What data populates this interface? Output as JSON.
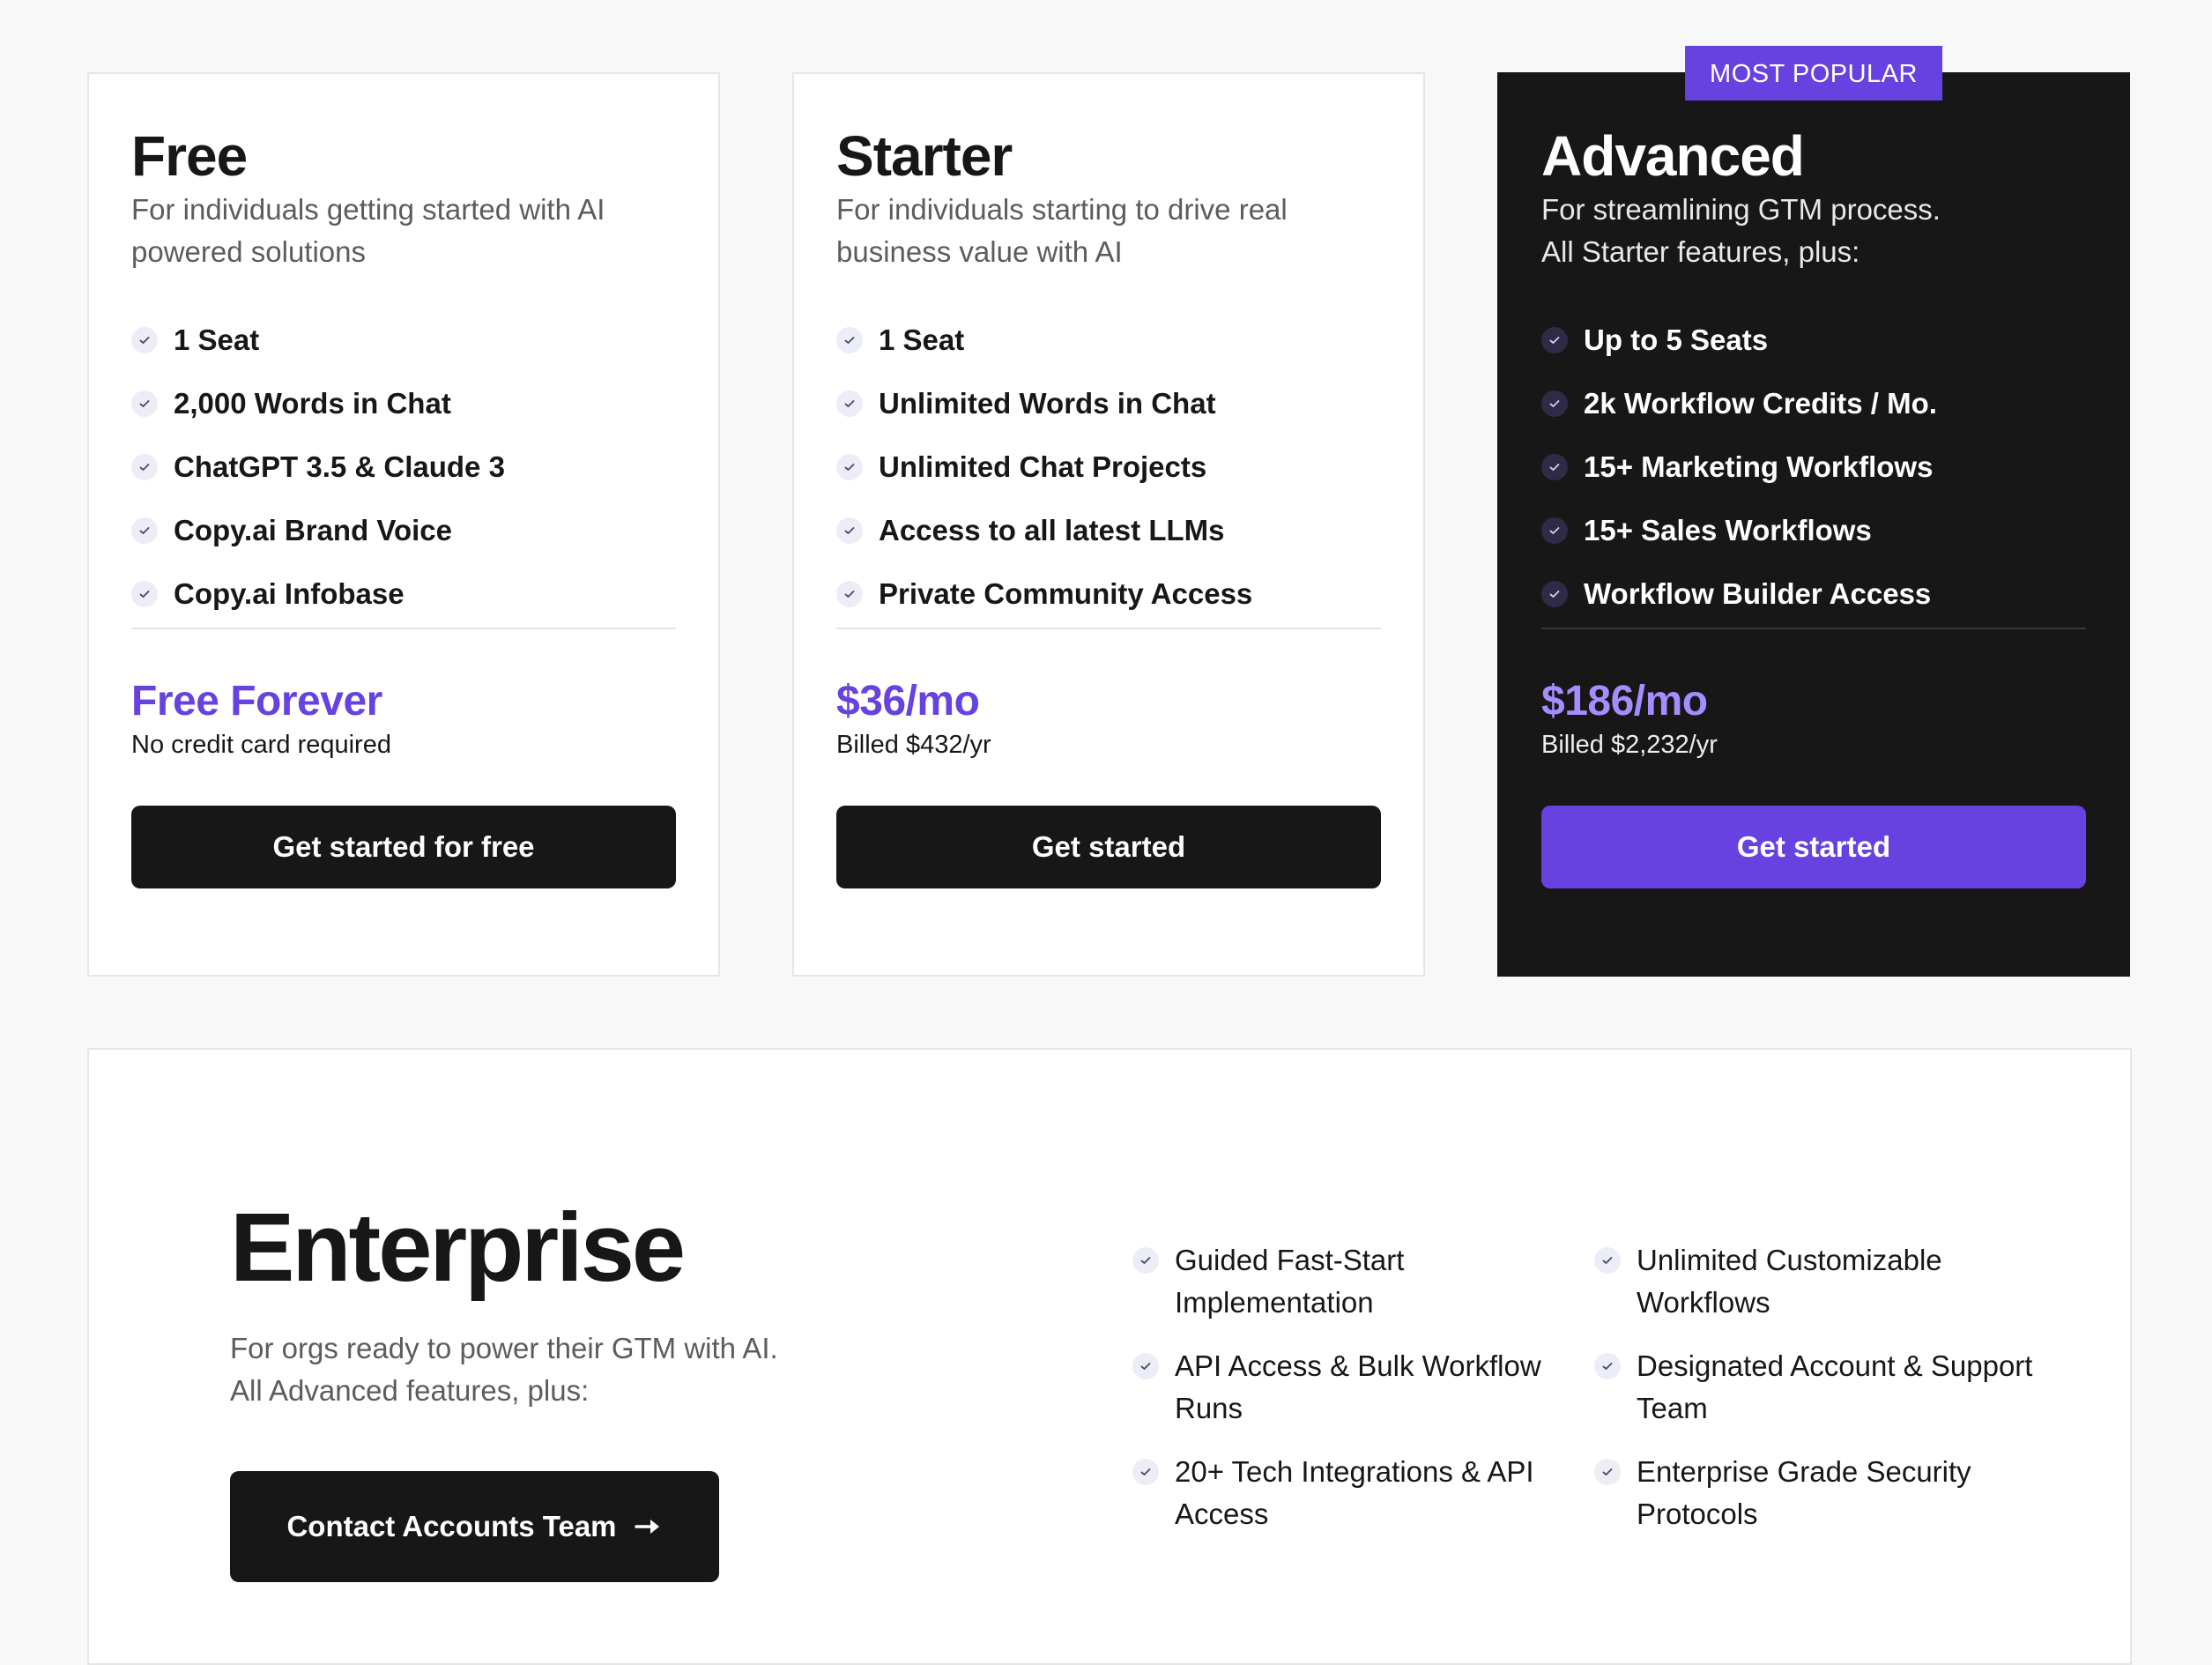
{
  "plans": {
    "free": {
      "title": "Free",
      "description": "For individuals getting started with AI powered solutions",
      "features": [
        "1 Seat",
        "2,000 Words in Chat",
        "ChatGPT 3.5 & Claude 3",
        "Copy.ai Brand Voice",
        "Copy.ai Infobase"
      ],
      "price": "Free Forever",
      "price_note": "No credit card required",
      "cta": "Get started for free"
    },
    "starter": {
      "title": "Starter",
      "description": "For individuals starting to drive real business value with AI",
      "features": [
        "1 Seat",
        "Unlimited Words in Chat",
        "Unlimited Chat Projects",
        "Access to all latest LLMs",
        "Private Community Access"
      ],
      "price": "$36/mo",
      "price_note": "Billed $432/yr",
      "cta": "Get started"
    },
    "advanced": {
      "badge": "MOST POPULAR",
      "title": "Advanced",
      "description_line1": "For streamlining GTM process.",
      "description_line2": "All Starter features, plus:",
      "features": [
        "Up to 5 Seats",
        "2k Workflow Credits / Mo.",
        "15+ Marketing Workflows",
        "15+ Sales Workflows",
        "Workflow Builder Access"
      ],
      "price": "$186/mo",
      "price_note": "Billed $2,232/yr",
      "cta": "Get started"
    }
  },
  "enterprise": {
    "title": "Enterprise",
    "description_line1": "For orgs ready to power their GTM with AI.",
    "description_line2": "All Advanced features, plus:",
    "cta": "Contact Accounts Team",
    "features_col1": [
      "Guided Fast-Start Implementation",
      "API Access & Bulk Workflow Runs",
      "20+ Tech Integrations & API Access"
    ],
    "features_col2": [
      "Unlimited Customizable Workflows",
      "Designated Account & Support Team",
      "Enterprise Grade Security Protocols"
    ]
  },
  "colors": {
    "accent": "#6842e0",
    "dark": "#171717",
    "background": "#f8f8f8"
  },
  "icons": {
    "feature_check": "check-icon",
    "cta_arrow": "arrow-right-icon"
  }
}
